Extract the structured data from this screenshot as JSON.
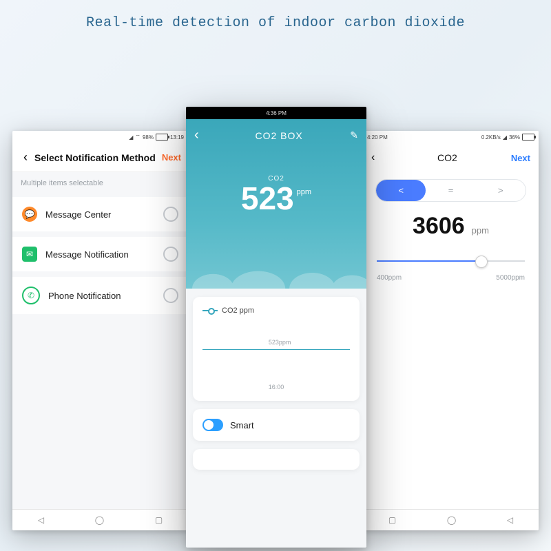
{
  "page_title": "Real-time detection of indoor carbon dioxide",
  "left": {
    "status": {
      "battery_pct": "98%",
      "time": "13:19"
    },
    "header": {
      "title": "Select Notification Method",
      "next": "Next"
    },
    "subtitle": "Multiple items selectable",
    "options": [
      {
        "label": "Message Center"
      },
      {
        "label": "Message Notification"
      },
      {
        "label": "Phone Notification"
      }
    ]
  },
  "center": {
    "status": {
      "time": "4:36 PM"
    },
    "header": {
      "title": "CO2 BOX"
    },
    "hero": {
      "label": "CO2",
      "value": "523",
      "unit": "ppm"
    },
    "chart": {
      "legend": "CO2 ppm",
      "value_label": "523ppm",
      "x_label": "16:00"
    },
    "smart_label": "Smart"
  },
  "right": {
    "status": {
      "speed": "0.2KB/s",
      "battery_pct": "36%",
      "time": "4:20 PM"
    },
    "header": {
      "title": "CO2",
      "next": "Next"
    },
    "segments": {
      "lt": "<",
      "eq": "=",
      "gt": ">"
    },
    "reading": {
      "value": "3606",
      "unit": "ppm"
    },
    "slider": {
      "min_label": "400ppm",
      "max_label": "5000ppm",
      "fill_pct": 70
    }
  },
  "chart_data": {
    "type": "line",
    "title": "CO2 ppm",
    "x": [
      "16:00"
    ],
    "series": [
      {
        "name": "CO2 ppm",
        "values": [
          523
        ]
      }
    ],
    "ylabel": "ppm",
    "related_readings": {
      "center_current_ppm": 523,
      "right_selected_ppm": 3606,
      "right_range_ppm": [
        400,
        5000
      ]
    }
  }
}
